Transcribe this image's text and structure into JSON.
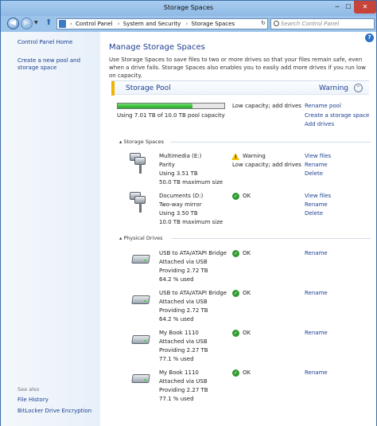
{
  "window": {
    "title": "Storage Spaces",
    "min_glyph": "─",
    "max_glyph": "☐",
    "close_glyph": "✕"
  },
  "nav": {
    "breadcrumbs": [
      "Control Panel",
      "System and Security",
      "Storage Spaces"
    ],
    "search_placeholder": "Search Control Panel"
  },
  "sidebar": {
    "home": "Control Panel Home",
    "create_pool": "Create a new pool and storage space",
    "see_also_label": "See also",
    "see_also": [
      "File History",
      "BitLocker Drive Encryption"
    ]
  },
  "main": {
    "title": "Manage Storage Spaces",
    "description": "Use Storage Spaces to save files to two or more drives so that your files remain safe, even when a drive fails. Storage Spaces also enables you to easily add more drives if you run low on capacity.",
    "help_glyph": "?"
  },
  "pool": {
    "title": "Storage Pool",
    "status": "Warning",
    "collapse_glyph": "⌃",
    "capacity_text": "Using 7.01 TB of 10.0 TB pool capacity",
    "capacity_fraction": 0.701,
    "alert": "Low capacity; add drives",
    "actions": [
      "Rename pool",
      "Create a storage space",
      "Add drives"
    ]
  },
  "storage_spaces": {
    "heading": "Storage Spaces",
    "items": [
      {
        "name": "Multimedia (E:)",
        "layout": "Parity",
        "usage": "Using 3.51 TB",
        "max": "50.0 TB maximum size",
        "status": "Warning",
        "status_detail": "Low capacity; add drives",
        "actions": [
          "View files",
          "Rename",
          "Delete"
        ]
      },
      {
        "name": "Documents (D:)",
        "layout": "Two-way mirror",
        "usage": "Using 3.50 TB",
        "max": "10.0 TB maximum size",
        "status": "OK",
        "status_detail": "",
        "actions": [
          "View files",
          "Rename",
          "Delete"
        ]
      }
    ]
  },
  "physical_drives": {
    "heading": "Physical Drives",
    "items": [
      {
        "name": "USB to ATA/ATAPI Bridge",
        "attached": "Attached via USB",
        "providing": "Providing 2.72 TB",
        "used": "64.2 % used",
        "status": "OK",
        "action": "Rename"
      },
      {
        "name": "USB to ATA/ATAPI Bridge",
        "attached": "Attached via USB",
        "providing": "Providing 2.72 TB",
        "used": "64.2 % used",
        "status": "OK",
        "action": "Rename"
      },
      {
        "name": "My Book 1110",
        "attached": "Attached via USB",
        "providing": "Providing 2.27 TB",
        "used": "77.1 % used",
        "status": "OK",
        "action": "Rename"
      },
      {
        "name": "My Book 1110",
        "attached": "Attached via USB",
        "providing": "Providing 2.27 TB",
        "used": "77.1 % used",
        "status": "OK",
        "action": "Rename"
      }
    ]
  },
  "colors": {
    "accent_warning": "#f0b400",
    "link": "#1a3f8f",
    "ok": "#2f9b2f",
    "capacity_fill": "#26a826"
  }
}
